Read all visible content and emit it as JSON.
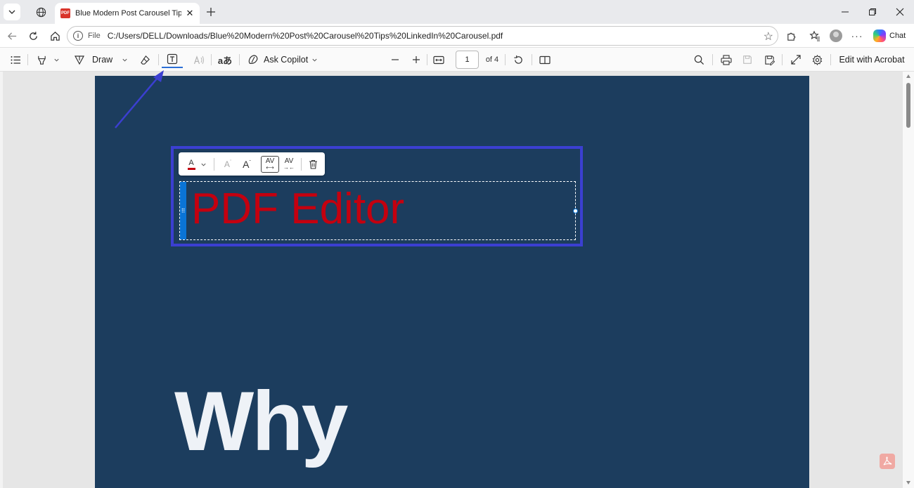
{
  "browser": {
    "tab_title": "Blue Modern Post Carousel Tips Li",
    "favicon_label": "PDF",
    "new_tab_icon": "plus-icon",
    "address": {
      "scheme": "File",
      "url": "C:/Users/DELL/Downloads/Blue%20Modern%20Post%20Carousel%20Tips%20LinkedIn%20Carousel.pdf"
    },
    "chat_label": "Chat"
  },
  "pdf_toolbar": {
    "draw_label": "Draw",
    "ask_copilot_label": "Ask Copilot",
    "page_number": "1",
    "page_total": "of 4",
    "edit_with_acrobat_label": "Edit with Acrobat"
  },
  "text_edit_toolbar": {
    "font_color": "#c4000f",
    "font_color_glyph": "A",
    "decrease_size_glyph": "A",
    "increase_size_glyph": "A",
    "wider_spacing_glyph": "AV",
    "narrower_spacing_glyph": "AV"
  },
  "document": {
    "background_color": "#1c3d5e",
    "edited_text": "PDF Editor",
    "heading_text": "Why"
  },
  "annotation_colors": {
    "frame": "#3b3fd1",
    "arrow": "#3b3fd1"
  }
}
